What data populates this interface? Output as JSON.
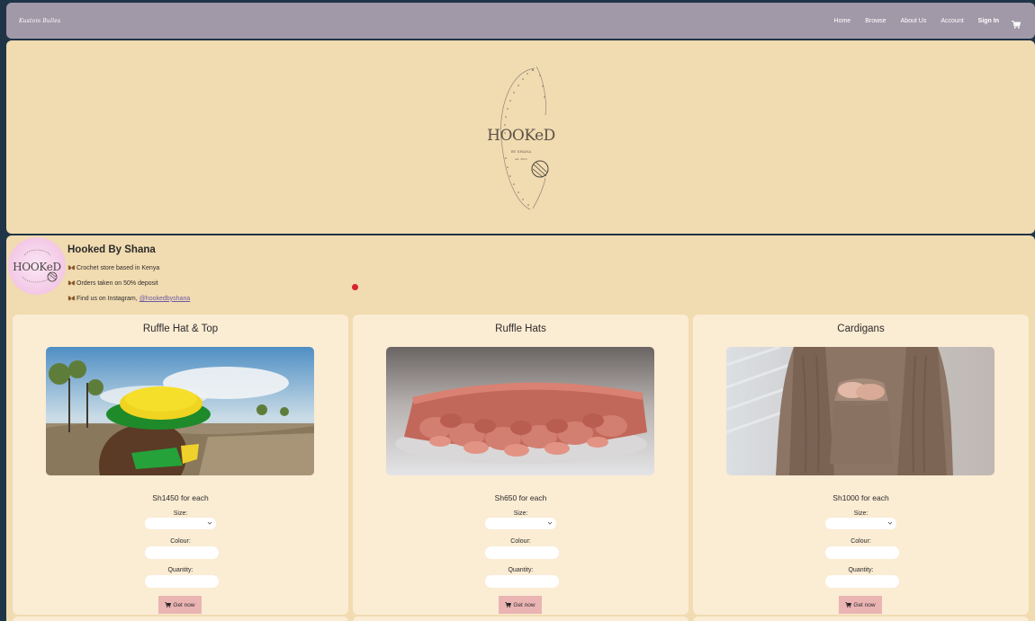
{
  "navbar": {
    "brand": "Kustom Bulles",
    "links": [
      "Home",
      "Browse",
      "About Us",
      "Account"
    ],
    "sign_in": "Sign In",
    "cart_icon": "cart-icon"
  },
  "banner": {
    "logo_icon": "hooked-logo-icon"
  },
  "store": {
    "name": "Hooked By Shana",
    "lines": [
      "Crochet store based in Kenya",
      "Orders taken on 50% deposit",
      "Find us on Instagram,"
    ],
    "instagram": "@hookedbyshana",
    "bullet_icon": "butterfly-icon"
  },
  "products": [
    {
      "title": "Ruffle Hat & Top",
      "price": "Sh1450 for each",
      "size_label": "Size:",
      "colour_label": "Colour:",
      "quantity_label": "Quantity:",
      "button": "Get now"
    },
    {
      "title": "Ruffle Hats",
      "price": "Sh650 for each",
      "size_label": "Size:",
      "colour_label": "Colour:",
      "quantity_label": "Quantity:",
      "button": "Get now"
    },
    {
      "title": "Cardigans",
      "price": "Sh1000 for each",
      "size_label": "Size:",
      "colour_label": "Colour:",
      "quantity_label": "Quantity:",
      "button": "Get now"
    }
  ],
  "colors": {
    "navbar": "#a199a8",
    "section_bg": "#f1dbb0",
    "card_bg": "#fbecd4",
    "button_bg": "#eab4b3",
    "page_bg": "#1f3447"
  }
}
